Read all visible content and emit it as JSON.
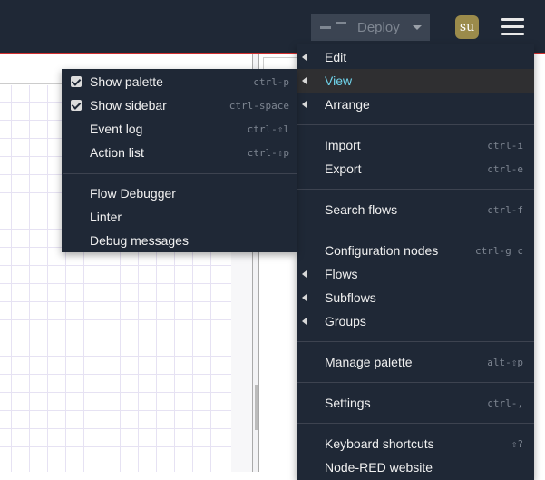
{
  "header": {
    "deploy_label": "Deploy",
    "avatar_initials": "su"
  },
  "main_menu": {
    "groups": [
      [
        {
          "label": "Edit",
          "submenu": true
        },
        {
          "label": "View",
          "submenu": true,
          "active": true
        },
        {
          "label": "Arrange",
          "submenu": true
        }
      ],
      [
        {
          "label": "Import",
          "shortcut": "ctrl-i"
        },
        {
          "label": "Export",
          "shortcut": "ctrl-e"
        }
      ],
      [
        {
          "label": "Search flows",
          "shortcut": "ctrl-f"
        }
      ],
      [
        {
          "label": "Configuration nodes",
          "shortcut": "ctrl-g c"
        },
        {
          "label": "Flows",
          "submenu": true
        },
        {
          "label": "Subflows",
          "submenu": true
        },
        {
          "label": "Groups",
          "submenu": true
        }
      ],
      [
        {
          "label": "Manage palette",
          "shortcut": "alt-⇧p"
        }
      ],
      [
        {
          "label": "Settings",
          "shortcut": "ctrl-,"
        }
      ],
      [
        {
          "label": "Keyboard shortcuts",
          "shortcut": "⇧?"
        },
        {
          "label": "Node-RED website"
        }
      ]
    ]
  },
  "view_menu": {
    "groups": [
      [
        {
          "label": "Show palette",
          "shortcut": "ctrl-p",
          "checked": true
        },
        {
          "label": "Show sidebar",
          "shortcut": "ctrl-space",
          "checked": true
        },
        {
          "label": "Event log",
          "shortcut": "ctrl-⇧l"
        },
        {
          "label": "Action list",
          "shortcut": "ctrl-⇧p"
        }
      ],
      [
        {
          "label": "Flow Debugger"
        },
        {
          "label": "Linter"
        },
        {
          "label": "Debug messages"
        }
      ]
    ]
  },
  "colors": {
    "header": "#1f2836",
    "accent_active": "#6fd3ea",
    "deploy_bg": "#3b4452",
    "avatar": "#9b8b4b",
    "red_bar": "#d32f2f"
  }
}
